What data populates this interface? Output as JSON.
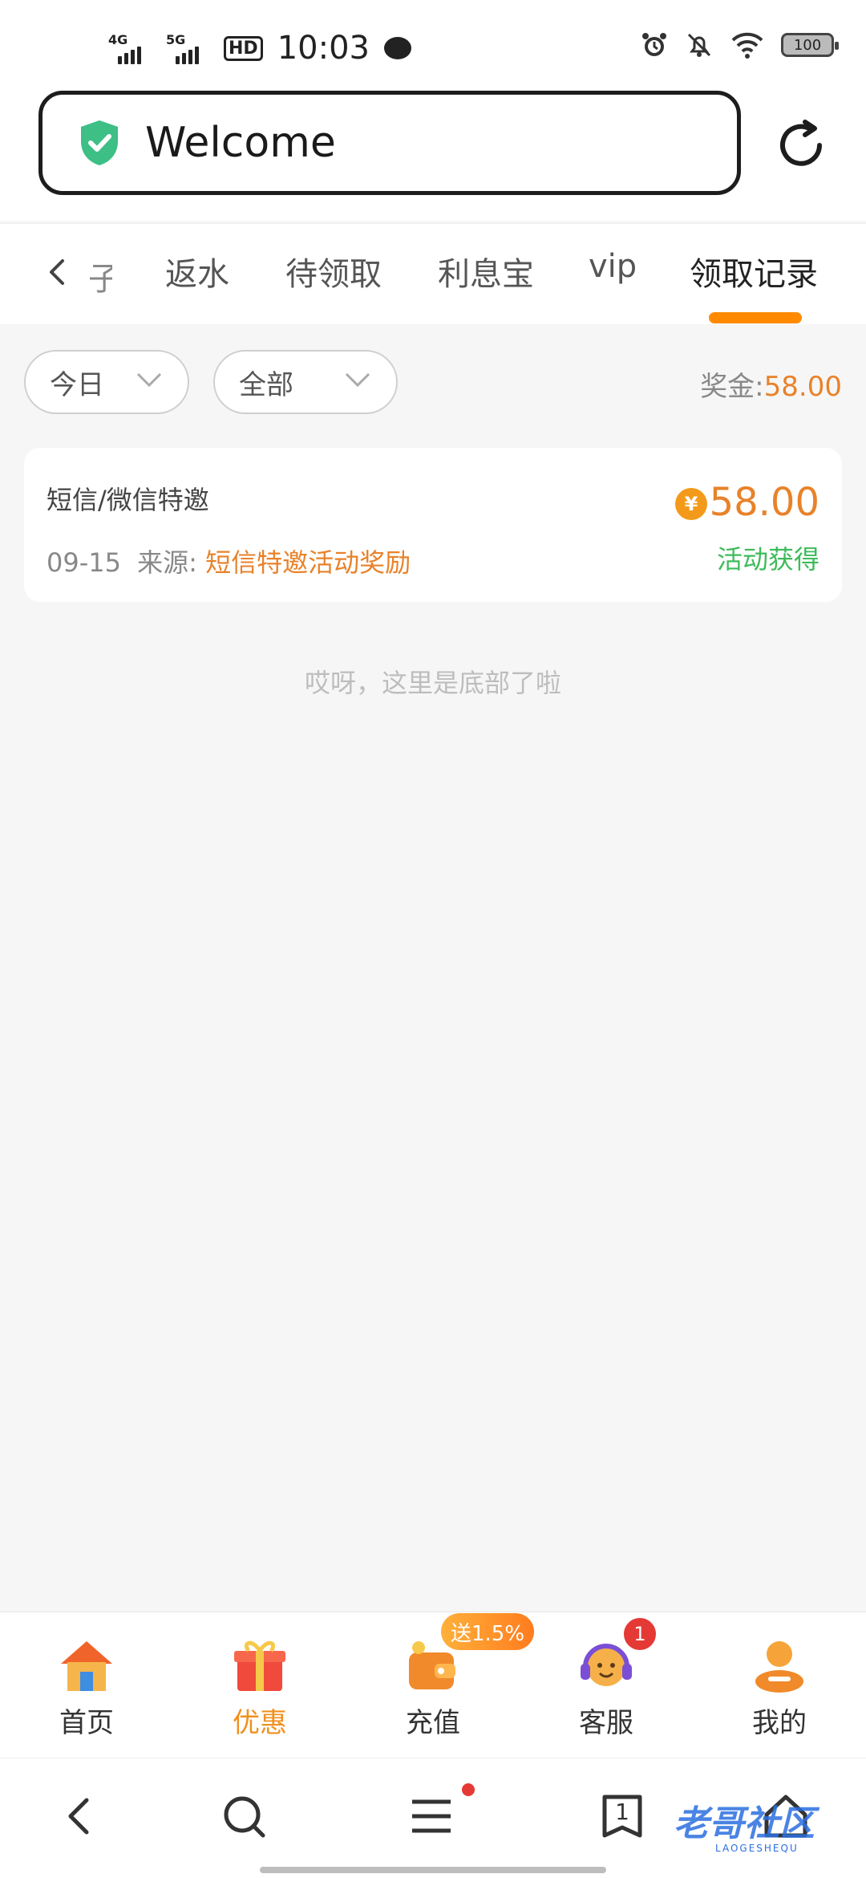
{
  "status_bar": {
    "net1": "4G",
    "net2": "5G",
    "hd": "HD",
    "time": "10:03",
    "battery": "100"
  },
  "browser": {
    "url_text": "Welcome"
  },
  "tabs": {
    "partial": "子",
    "items": [
      {
        "label": "返水"
      },
      {
        "label": "待领取"
      },
      {
        "label": "利息宝"
      },
      {
        "label": "vip"
      },
      {
        "label": "领取记录"
      }
    ],
    "active_index": 4
  },
  "filters": {
    "date": "今日",
    "type": "全部",
    "bonus_label": "奖金:",
    "bonus_value": "58.00"
  },
  "records": [
    {
      "title": "短信/微信特邀",
      "date": "09-15",
      "source_label": "来源:",
      "source": "短信特邀活动奖励",
      "currency_symbol": "¥",
      "amount": "58.00",
      "status": "活动获得"
    }
  ],
  "end_text": "哎呀，这里是底部了啦",
  "bottom_nav": {
    "items": [
      {
        "label": "首页"
      },
      {
        "label": "优惠"
      },
      {
        "label": "充值"
      },
      {
        "label": "客服"
      },
      {
        "label": "我的"
      }
    ],
    "active_index": 1,
    "promo_badge": "送1.5%",
    "service_count": "1"
  },
  "system_nav": {
    "tab_count": "1"
  },
  "watermark": {
    "text": "老哥社区",
    "sub": "LAOGESHEQU"
  },
  "colors": {
    "accent": "#ff8a00",
    "amount": "#e8822a",
    "success": "#3dbb5a"
  }
}
